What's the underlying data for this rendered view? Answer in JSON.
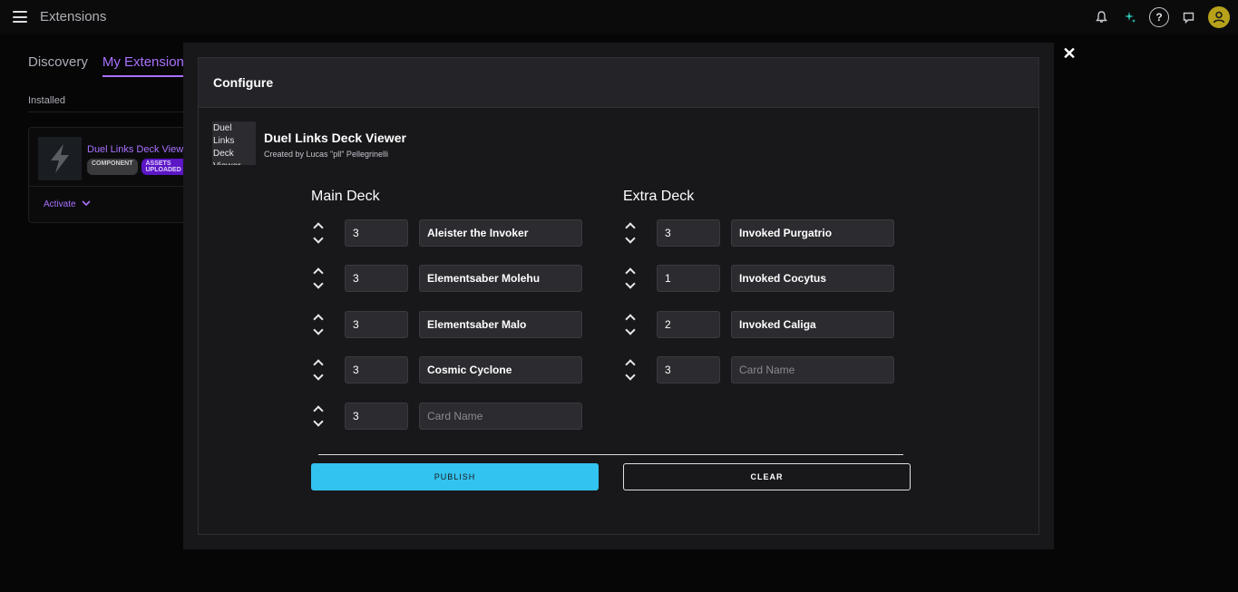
{
  "app": {
    "title": "Extensions"
  },
  "background": {
    "tabs": [
      {
        "label": "Discovery"
      },
      {
        "label": "My Extensions"
      }
    ],
    "installed_label": "Installed",
    "card": {
      "name": "Duel Links Deck Viewer",
      "badges": [
        "COMPONENT",
        "ASSETS UPLOADED"
      ],
      "activate_label": "Activate"
    }
  },
  "modal": {
    "title": "Configure",
    "close_icon": "close-icon",
    "extension": {
      "image_alt": "Duel Links Deck Viewer",
      "title": "Duel Links Deck Viewer",
      "author": "Created by Lucas \"pll\" Pellegrinelli"
    },
    "card_placeholder": "Card Name",
    "main_deck": {
      "title": "Main Deck",
      "rows": [
        {
          "qty": "3",
          "card": "Aleister the Invoker"
        },
        {
          "qty": "3",
          "card": "Elementsaber Molehu"
        },
        {
          "qty": "3",
          "card": "Elementsaber Malo"
        },
        {
          "qty": "3",
          "card": "Cosmic Cyclone"
        },
        {
          "qty": "3",
          "card": ""
        }
      ]
    },
    "extra_deck": {
      "title": "Extra Deck",
      "rows": [
        {
          "qty": "3",
          "card": "Invoked Purgatrio"
        },
        {
          "qty": "1",
          "card": "Invoked Cocytus"
        },
        {
          "qty": "2",
          "card": "Invoked Caliga"
        },
        {
          "qty": "3",
          "card": ""
        }
      ]
    },
    "publish_label": "PUBLISH",
    "clear_label": "CLEAR"
  },
  "colors": {
    "accent": "#a970ff",
    "publish": "#33c3f0",
    "avatar": "#b7a11a"
  }
}
